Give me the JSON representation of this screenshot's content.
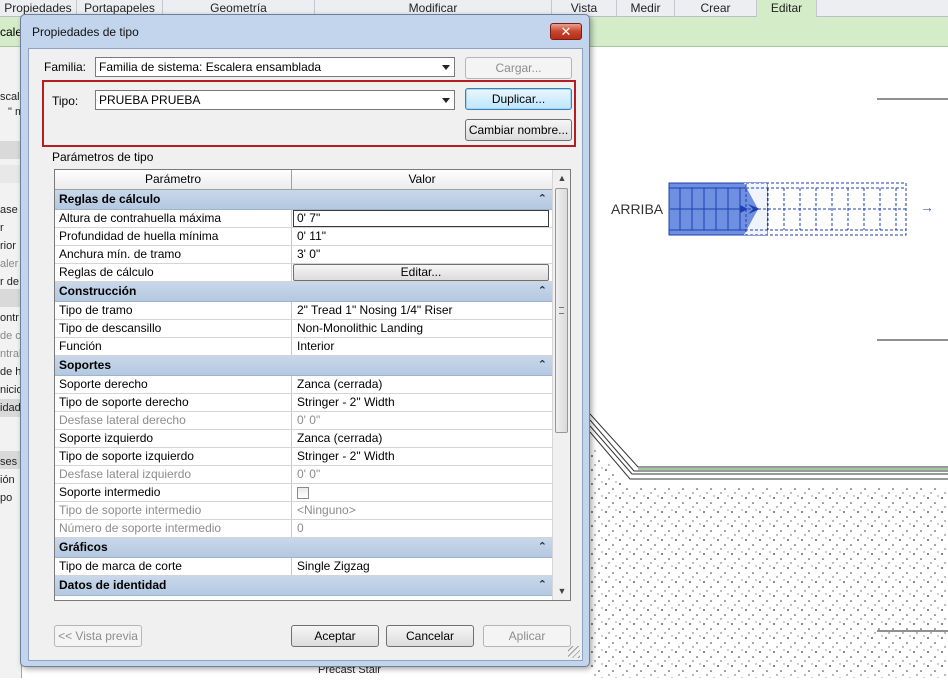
{
  "ribbon": {
    "tabs": [
      {
        "label": "Propiedades",
        "active": false
      },
      {
        "label": "Portapapeles",
        "active": false
      },
      {
        "label": "Geometría",
        "active": false
      },
      {
        "label": "Modificar",
        "active": false
      },
      {
        "label": "Vista",
        "active": false
      },
      {
        "label": "Medir",
        "active": false
      },
      {
        "label": "Crear",
        "active": false
      },
      {
        "label": "Editar",
        "active": true
      }
    ],
    "context_fragment": "cale"
  },
  "left_panel": {
    "fragments": [
      "scal",
      "\" m",
      "ase",
      "r",
      "rior",
      "aler",
      "r de",
      "ontr",
      "de c",
      "ntrah",
      "de h",
      "nicio",
      "idad",
      "ses",
      "ión",
      "po"
    ]
  },
  "canvas": {
    "label": "ARRIBA",
    "arrow": "→"
  },
  "project_browser": {
    "item": "Precast Stair"
  },
  "dialog": {
    "title": "Propiedades de tipo",
    "close_symbol": "✕",
    "family_label": "Familia:",
    "family_value": "Familia de sistema: Escalera ensamblada",
    "load_button": "Cargar...",
    "type_label": "Tipo:",
    "type_value": "PRUEBA PRUEBA",
    "duplicate_button": "Duplicar...",
    "rename_button": "Cambiar nombre...",
    "params_label": "Parámetros de tipo",
    "col_param": "Parámetro",
    "col_value": "Valor",
    "groups": [
      {
        "name": "Reglas de cálculo",
        "rows": [
          {
            "param": "Altura de contrahuella máxima",
            "value": "0'  7\"",
            "kind": "input"
          },
          {
            "param": "Profundidad de huella mínima",
            "value": "0'  11\"",
            "kind": "text"
          },
          {
            "param": "Anchura mín. de tramo",
            "value": "3'  0\"",
            "kind": "text"
          },
          {
            "param": "Reglas de cálculo",
            "value": "Editar...",
            "kind": "button"
          }
        ]
      },
      {
        "name": "Construcción",
        "rows": [
          {
            "param": "Tipo de tramo",
            "value": "2\" Tread 1\" Nosing 1/4\" Riser",
            "kind": "text"
          },
          {
            "param": "Tipo de descansillo",
            "value": "Non-Monolithic Landing",
            "kind": "text"
          },
          {
            "param": "Función",
            "value": "Interior",
            "kind": "text"
          }
        ]
      },
      {
        "name": "Soportes",
        "rows": [
          {
            "param": "Soporte derecho",
            "value": "Zanca (cerrada)",
            "kind": "text"
          },
          {
            "param": "Tipo de soporte derecho",
            "value": "Stringer - 2\" Width",
            "kind": "text"
          },
          {
            "param": "Desfase lateral derecho",
            "value": "0'  0\"",
            "kind": "disabled"
          },
          {
            "param": "Soporte izquierdo",
            "value": "Zanca (cerrada)",
            "kind": "text"
          },
          {
            "param": "Tipo de soporte izquierdo",
            "value": "Stringer - 2\" Width",
            "kind": "text"
          },
          {
            "param": "Desfase lateral izquierdo",
            "value": "0'  0\"",
            "kind": "disabled"
          },
          {
            "param": "Soporte intermedio",
            "value": "",
            "kind": "checkbox"
          },
          {
            "param": "Tipo de soporte intermedio",
            "value": "<Ninguno>",
            "kind": "disabled"
          },
          {
            "param": "Número de soporte intermedio",
            "value": "0",
            "kind": "disabled"
          }
        ]
      },
      {
        "name": "Gráficos",
        "rows": [
          {
            "param": "Tipo de marca de corte",
            "value": "Single Zigzag",
            "kind": "text"
          }
        ]
      },
      {
        "name": "Datos de identidad",
        "rows": []
      }
    ],
    "collapse_symbol": "⌃",
    "preview_button": "<< Vista previa",
    "ok_button": "Aceptar",
    "cancel_button": "Cancelar",
    "apply_button": "Aplicar"
  }
}
